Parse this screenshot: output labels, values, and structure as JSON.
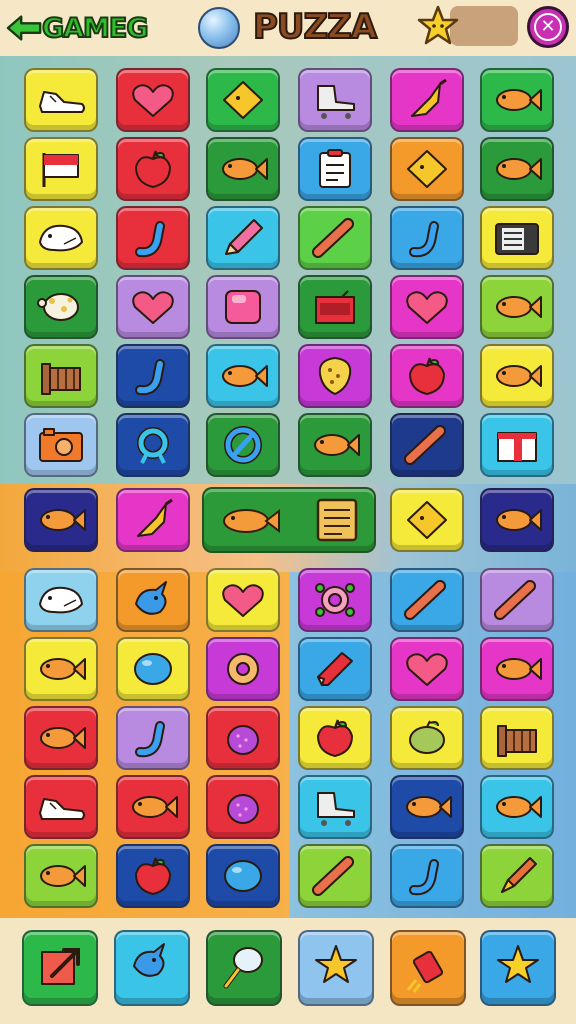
{
  "header": {
    "brand": "GAMEG",
    "title": "PUZZA",
    "back_icon": "green-arrow-icon",
    "orb_icon": "globe-orb-icon",
    "star_icon": "gold-star-icon",
    "close_icon": "close-icon",
    "close_symbol": "✕",
    "colors": {
      "brand": "#2fbf2a",
      "title": "#8a4b22",
      "close": "#c82fb4"
    }
  },
  "grid": {
    "tiles": [
      {
        "icon": "sneaker-icon",
        "color": "#f5e93a"
      },
      {
        "icon": "heart-icon",
        "color": "#e8303c"
      },
      {
        "icon": "diamond-gem-icon",
        "color": "#2db84a"
      },
      {
        "icon": "skate-icon",
        "color": "#b88ae0"
      },
      {
        "icon": "feather-broom-icon",
        "color": "#e636c8"
      },
      {
        "icon": "fish-icon",
        "color": "#2db84a"
      },
      {
        "icon": "flag-icon",
        "color": "#f5e93a"
      },
      {
        "icon": "apple-icon",
        "color": "#e8303c"
      },
      {
        "icon": "fish-icon",
        "color": "#2b9a3a"
      },
      {
        "icon": "clipboard-icon",
        "color": "#3aa7e6"
      },
      {
        "icon": "diamond-gem-icon",
        "color": "#f39a2a"
      },
      {
        "icon": "fish-icon",
        "color": "#2b9a3a"
      },
      {
        "icon": "whale-icon",
        "color": "#f5e93a"
      },
      {
        "icon": "candy-cane-icon",
        "color": "#e8303c"
      },
      {
        "icon": "pencil-icon",
        "color": "#3ac4e8"
      },
      {
        "icon": "stick-icon",
        "color": "#5cd046"
      },
      {
        "icon": "candy-cane-icon",
        "color": "#3aa7e6"
      },
      {
        "icon": "radio-icon",
        "color": "#f5e93a"
      },
      {
        "icon": "turtle-icon",
        "color": "#2b9a3a"
      },
      {
        "icon": "heart-icon",
        "color": "#b88ae0"
      },
      {
        "icon": "cube-gem-icon",
        "color": "#b88ae0"
      },
      {
        "icon": "briefcase-icon",
        "color": "#2b9a3a"
      },
      {
        "icon": "heart-icon",
        "color": "#e636c8"
      },
      {
        "icon": "fish-icon",
        "color": "#8cd43a"
      },
      {
        "icon": "fence-icon",
        "color": "#8cd43a"
      },
      {
        "icon": "candy-cane-icon",
        "color": "#1e4aa8"
      },
      {
        "icon": "fish-icon",
        "color": "#3ac4e8"
      },
      {
        "icon": "shield-icon",
        "color": "#c83ad8"
      },
      {
        "icon": "apple-icon",
        "color": "#e636c8"
      },
      {
        "icon": "fish-icon",
        "color": "#f5e93a"
      },
      {
        "icon": "camera-icon",
        "color": "#9ec6ee"
      },
      {
        "icon": "ring-icon",
        "color": "#1e4aa8"
      },
      {
        "icon": "no-sign-icon",
        "color": "#2b9a3a"
      },
      {
        "icon": "fish-icon",
        "color": "#2b9a3a"
      },
      {
        "icon": "stick-icon",
        "color": "#1e3a8c"
      },
      {
        "icon": "gift-box-icon",
        "color": "#3ac4e8"
      }
    ],
    "mid_row": [
      {
        "icon": "fish-icon",
        "color": "#2a2a8c"
      },
      {
        "icon": "feather-broom-icon",
        "color": "#e636c8"
      },
      {
        "icon": "diamond-gem-icon",
        "color": "#f5e93a"
      },
      {
        "icon": "fish-icon",
        "color": "#2a2a8c"
      }
    ],
    "wide_tile": {
      "icons": [
        "fish-icon",
        "notepad-icon"
      ],
      "color": "#2d9a3a"
    },
    "lower_tiles": [
      {
        "icon": "whale-icon",
        "color": "#8fd2ee"
      },
      {
        "icon": "bird-icon",
        "color": "#f39a2a"
      },
      {
        "icon": "heart-icon",
        "color": "#f5e93a"
      },
      {
        "icon": "cog-ring-icon",
        "color": "#c83ad8"
      },
      {
        "icon": "stick-icon",
        "color": "#3aa7e6"
      },
      {
        "icon": "stick-icon",
        "color": "#b88ae0"
      },
      {
        "icon": "fish-icon",
        "color": "#f5e93a"
      },
      {
        "icon": "blob-icon",
        "color": "#f5e93a"
      },
      {
        "icon": "donut-icon",
        "color": "#c83ad8"
      },
      {
        "icon": "paint-tube-icon",
        "color": "#3aa7e6"
      },
      {
        "icon": "heart-icon",
        "color": "#e636c8"
      },
      {
        "icon": "fish-icon",
        "color": "#e636c8"
      },
      {
        "icon": "fish-icon",
        "color": "#e8303c"
      },
      {
        "icon": "candy-cane-icon",
        "color": "#b88ae0"
      },
      {
        "icon": "berry-icon",
        "color": "#e8303c"
      },
      {
        "icon": "apple-icon",
        "color": "#f5e93a"
      },
      {
        "icon": "melon-icon",
        "color": "#f5e93a"
      },
      {
        "icon": "fence-icon",
        "color": "#f5e93a"
      },
      {
        "icon": "sneaker-icon",
        "color": "#e8303c"
      },
      {
        "icon": "fish-icon",
        "color": "#e8303c"
      },
      {
        "icon": "berry-icon",
        "color": "#e8303c"
      },
      {
        "icon": "skate-icon",
        "color": "#3ac4e8"
      },
      {
        "icon": "fish-icon",
        "color": "#1e4aa8"
      },
      {
        "icon": "fish-icon",
        "color": "#3ac4e8"
      },
      {
        "icon": "fish-icon",
        "color": "#8cd43a"
      },
      {
        "icon": "apple-icon",
        "color": "#1e4aa8"
      },
      {
        "icon": "blob-icon",
        "color": "#1e4aa8"
      },
      {
        "icon": "stick-icon",
        "color": "#8cd43a"
      },
      {
        "icon": "candy-cane-icon",
        "color": "#3aa7e6"
      },
      {
        "icon": "brush-icon",
        "color": "#8cd43a"
      }
    ]
  },
  "toolbar": [
    {
      "icon": "share-arrow-icon",
      "color": "#2db84a"
    },
    {
      "icon": "bird-icon",
      "color": "#3ac4e8"
    },
    {
      "icon": "racket-icon",
      "color": "#2b9a3a"
    },
    {
      "icon": "pin-star-icon",
      "color": "#8fc4ee"
    },
    {
      "icon": "firecracker-icon",
      "color": "#f39a2a"
    },
    {
      "icon": "star-icon",
      "color": "#3aa7e6"
    }
  ]
}
